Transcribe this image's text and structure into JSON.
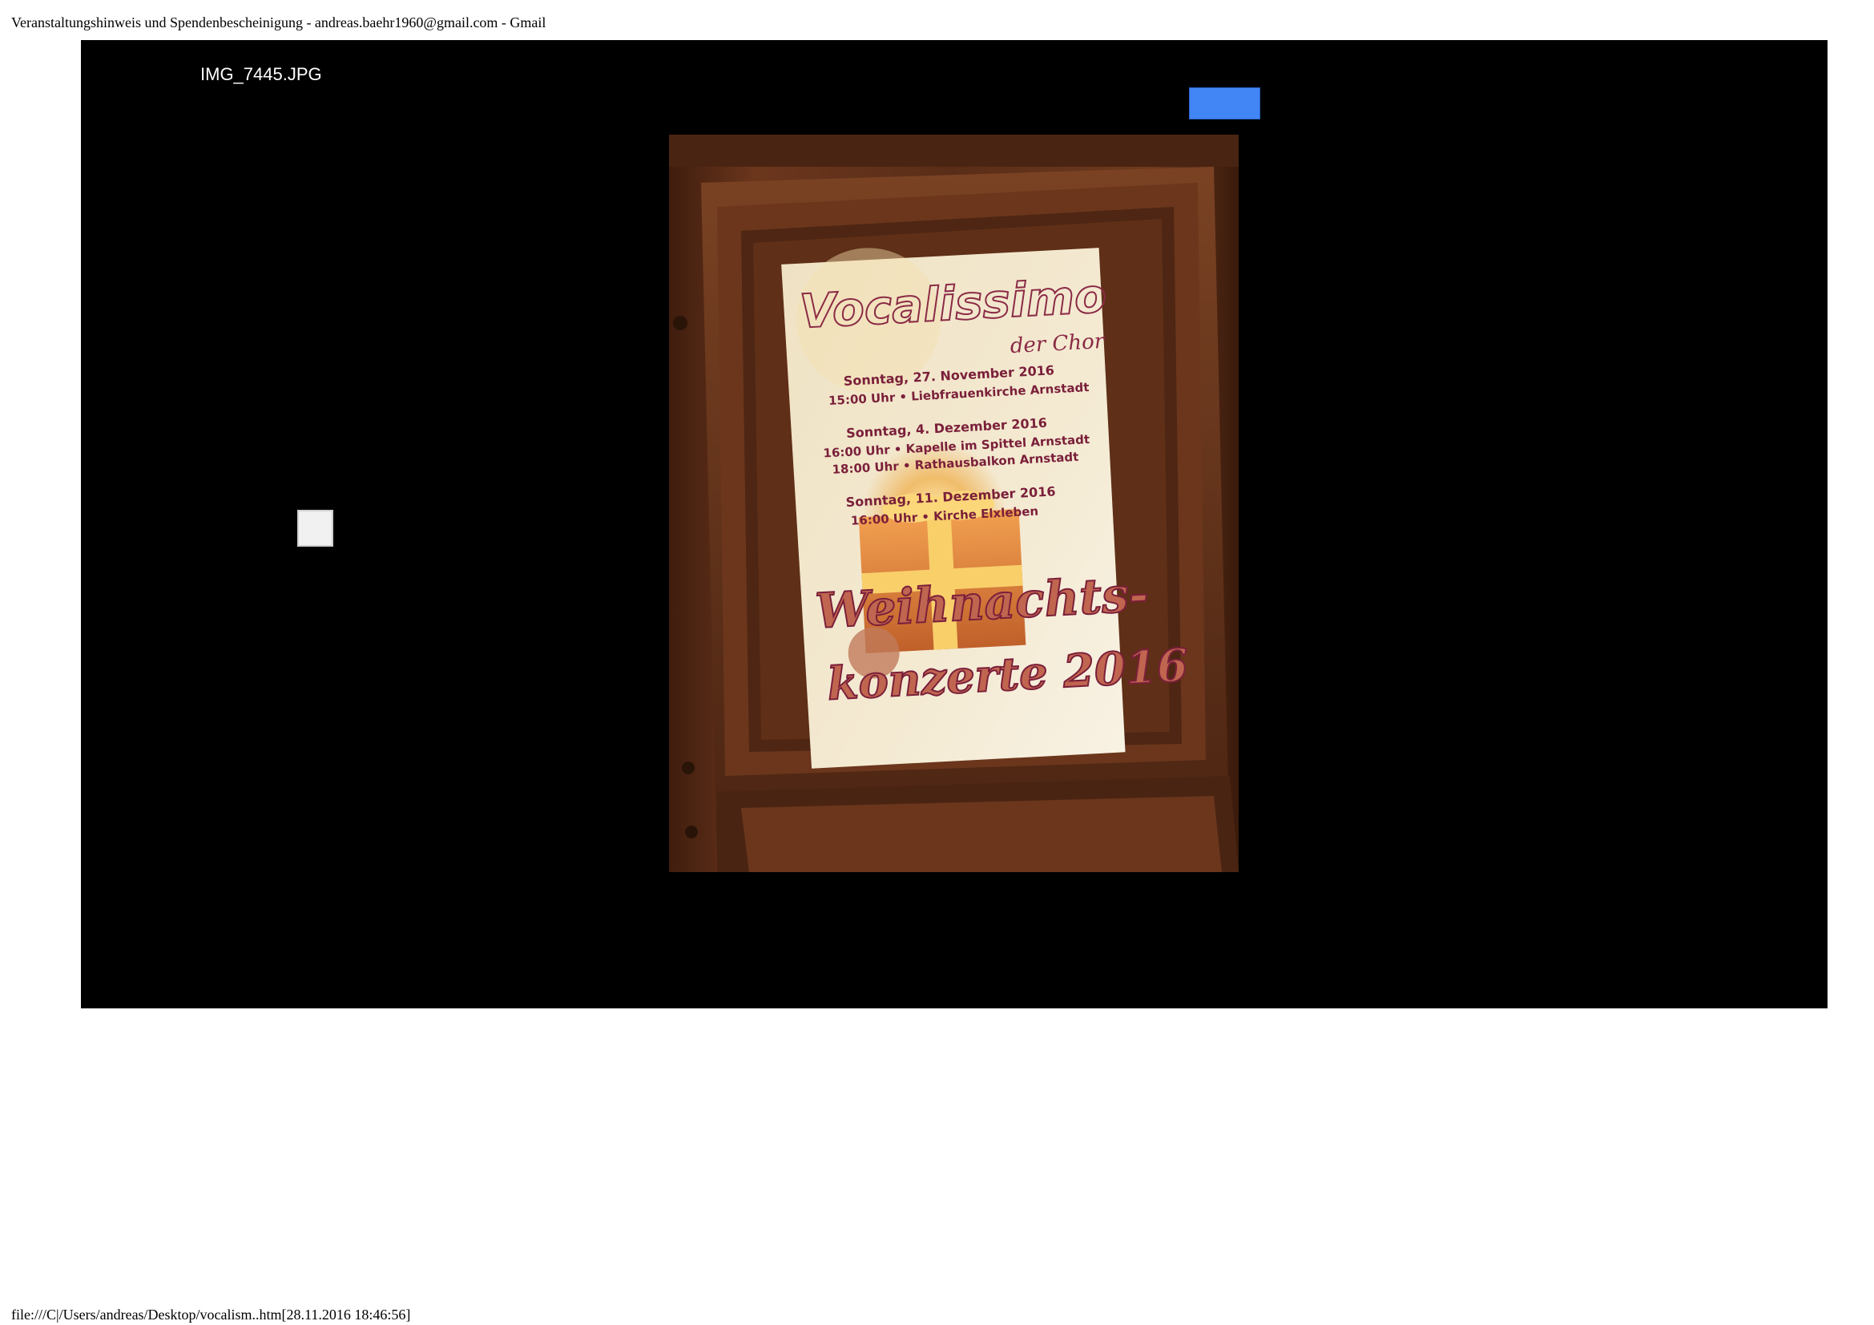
{
  "print_header": {
    "title": "Veranstaltungshinweis und Spendenbescheinigung - andreas.baehr1960@gmail.com - Gmail"
  },
  "viewer": {
    "filename": "IMG_7445.JPG"
  },
  "poster": {
    "title": "Vocalissimo",
    "subtitle": "der Chor",
    "events": [
      {
        "date": "Sonntag, 27. November 2016",
        "lines": [
          "15:00 Uhr • Liebfrauenkirche Arnstadt"
        ]
      },
      {
        "date": "Sonntag, 4. Dezember 2016",
        "lines": [
          "16:00 Uhr • Kapelle im Spittel Arnstadt",
          "18:00 Uhr • Rathausbalkon Arnstadt"
        ]
      },
      {
        "date": "Sonntag, 11. Dezember 2016",
        "lines": [
          "16:00 Uhr • Kirche Elxleben"
        ]
      }
    ],
    "headline_1": "Weihnachts-",
    "headline_2": "konzerte 2016"
  },
  "print_footer": {
    "path": "file:///C|/Users/andreas/Desktop/vocalism..htm[28.11.2016 18:46:56]"
  },
  "colors": {
    "viewer_background": "#000000",
    "accent_button": "#4285f4",
    "poster_text": "#7a1f3a",
    "wood": "#5a2d18"
  }
}
